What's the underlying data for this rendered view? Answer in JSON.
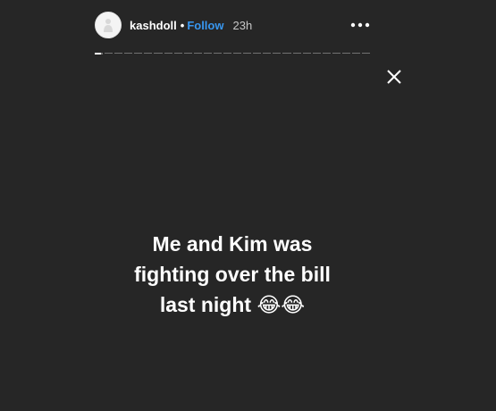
{
  "header": {
    "username": "kashdoll",
    "separator": "•",
    "follow_label": "Follow",
    "time": "23h",
    "avatar_icon": "user-avatar-icon",
    "more_icon": "more-horizontal-icon"
  },
  "progress": {
    "segments": 28,
    "current_segment": 1,
    "current_fill": 0.8
  },
  "close_icon": "close-icon",
  "caption": {
    "line1": "Me and Kim was",
    "line2": "fighting over the bill",
    "line3": "last night",
    "emoji": "😂😂"
  },
  "colors": {
    "background": "#262626",
    "follow": "#3897f0",
    "text": "#ffffff"
  }
}
